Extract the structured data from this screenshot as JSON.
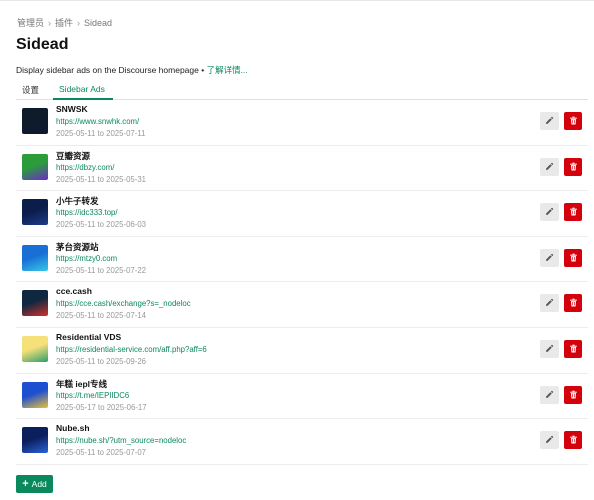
{
  "breadcrumb": [
    "管理员",
    "插件",
    "Sidead"
  ],
  "page_title": "Sidead",
  "description": {
    "text": "Display sidebar ads on the Discourse homepage • ",
    "link": "了解详情..."
  },
  "tabs": [
    {
      "label": "设置",
      "active": false
    },
    {
      "label": "Sidebar Ads",
      "active": true
    }
  ],
  "ads": [
    {
      "name": "SNWSK",
      "url": "https://www.snwhk.com/",
      "dates": "2025-05-11 to 2025-07-11",
      "thumb_colors": [
        "#0d1b2a",
        "#101a30"
      ]
    },
    {
      "name": "豆瓣资源",
      "url": "https://dbzy.com/",
      "dates": "2025-05-11 to 2025-05-31",
      "thumb_colors": [
        "#2a9d3a",
        "#6b2cc9"
      ]
    },
    {
      "name": "小牛子转发",
      "url": "https://idc333.top/",
      "dates": "2025-05-11 to 2025-06-03",
      "thumb_colors": [
        "#0b1d4a",
        "#1f3c8a"
      ]
    },
    {
      "name": "茅台资源站",
      "url": "https://mtzy0.com",
      "dates": "2025-05-11 to 2025-07-22",
      "thumb_colors": [
        "#1a6fd6",
        "#37c7e8"
      ]
    },
    {
      "name": "cce.cash",
      "url": "https://cce.cash/exchange?s=_nodeloc",
      "dates": "2025-05-11 to 2025-07-14",
      "thumb_colors": [
        "#0f2740",
        "#d3312c"
      ]
    },
    {
      "name": "Residential VDS",
      "url": "https://residential-service.com/aff.php?aff=6",
      "dates": "2025-05-11 to 2025-09-26",
      "thumb_colors": [
        "#f6e07a",
        "#2e9e6a"
      ]
    },
    {
      "name": "年糕 iepl专线",
      "url": "https://t.me/IEPIIDC6",
      "dates": "2025-05-17 to 2025-06-17",
      "thumb_colors": [
        "#1d4fd1",
        "#e8c23a"
      ]
    },
    {
      "name": "Nube.sh",
      "url": "https://nube.sh/?utm_source=nodeloc",
      "dates": "2025-05-11 to 2025-07-07",
      "thumb_colors": [
        "#0a1f5c",
        "#2b63d9"
      ]
    }
  ],
  "add_label": "Add",
  "icons": {
    "edit": "pencil-icon",
    "delete": "trash-icon",
    "add": "plus-icon",
    "breadcrumb_sep": "chevron-right-icon"
  },
  "colors": {
    "accent": "#0a8a5c",
    "danger": "#d4000b"
  }
}
